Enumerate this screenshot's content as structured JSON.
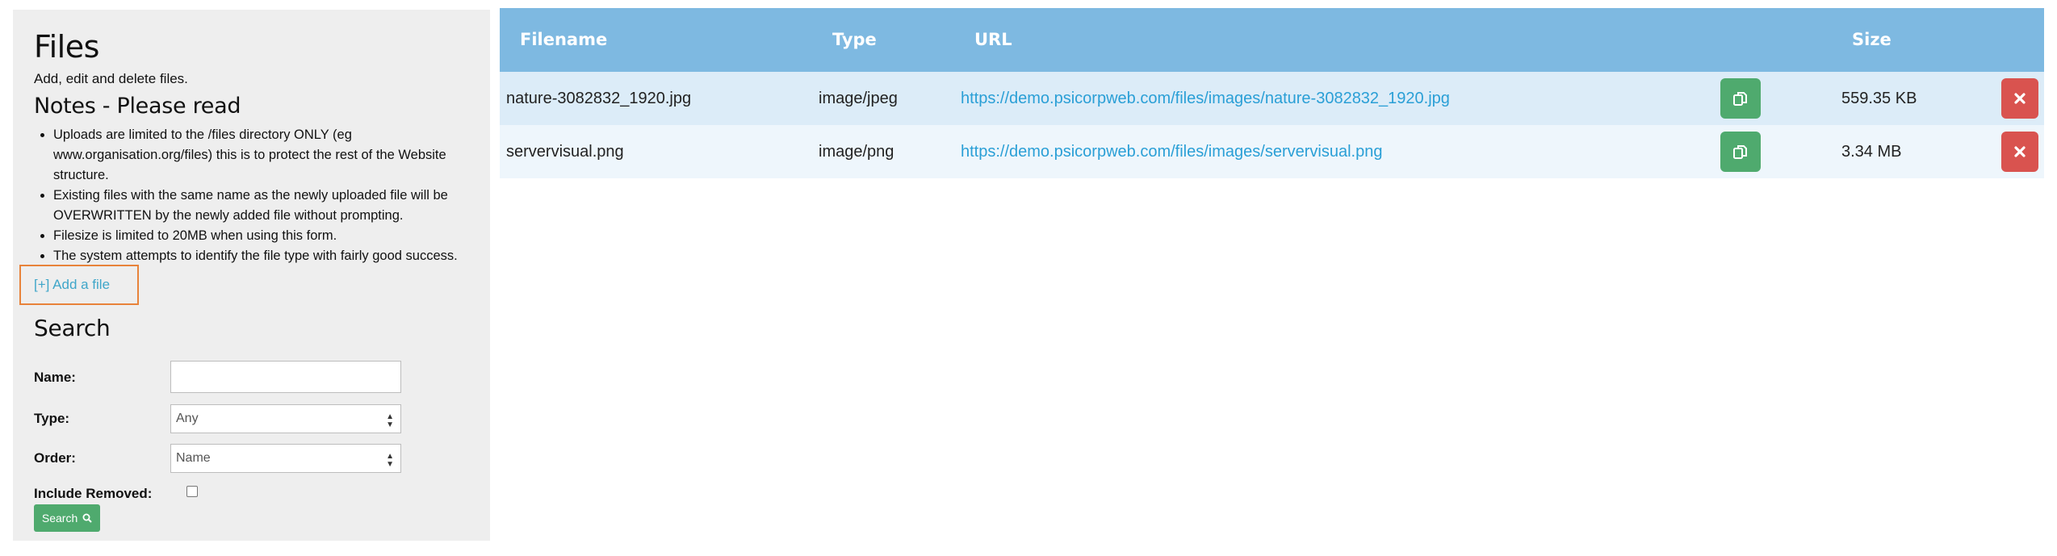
{
  "sidebar": {
    "title": "Files",
    "subtitle": "Add, edit and delete files.",
    "notes_title": "Notes - Please read",
    "notes": [
      "Uploads are limited to the /files directory ONLY (eg www.organisation.org/files) this is to protect the rest of the Website structure.",
      "Existing files with the same name as the newly uploaded file will be OVERWRITTEN by the newly added file without prompting.",
      "Filesize is limited to 20MB when using this form.",
      "The system attempts to identify the file type with fairly good success."
    ],
    "add_file_label": "[+] Add a file",
    "search": {
      "title": "Search",
      "name_label": "Name:",
      "name_value": "",
      "type_label": "Type:",
      "type_value": "Any",
      "order_label": "Order:",
      "order_value": "Name",
      "include_removed_label": "Include Removed:",
      "include_removed_checked": false,
      "button_label": "Search"
    }
  },
  "table": {
    "headers": {
      "filename": "Filename",
      "type": "Type",
      "url": "URL",
      "size": "Size"
    },
    "rows": [
      {
        "filename": "nature-3082832_1920.jpg",
        "type": "image/jpeg",
        "url": "https://demo.psicorpweb.com/files/images/nature-3082832_1920.jpg",
        "size": "559.35 KB"
      },
      {
        "filename": "servervisual.png",
        "type": "image/png",
        "url": "https://demo.psicorpweb.com/files/images/servervisual.png",
        "size": "3.34 MB"
      }
    ]
  },
  "colors": {
    "header_bg": "#7eb9e1",
    "row_odd": "#dcecf8",
    "row_even": "#eef6fc",
    "link": "#2a9fd6",
    "copy_button": "#4faa6e",
    "delete_button": "#d9534f",
    "add_file_border": "#e8833a"
  },
  "icons": {
    "copy": "copy-icon",
    "delete": "close-icon",
    "search": "search-icon"
  }
}
